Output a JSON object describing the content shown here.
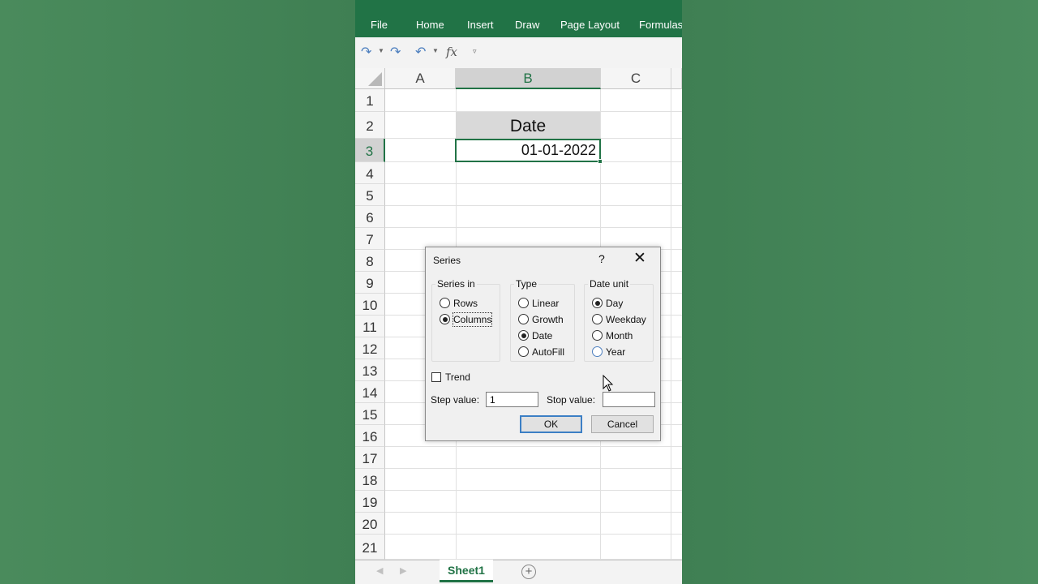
{
  "ribbon": {
    "tabs": [
      "File",
      "Home",
      "Insert",
      "Draw",
      "Page Layout",
      "Formulas"
    ]
  },
  "qat": {
    "icons": [
      "redo-icon",
      "redo-icon",
      "undo-icon",
      "function-icon",
      "customize-icon"
    ],
    "fx_label": "fx"
  },
  "grid": {
    "columns": [
      "A",
      "B",
      "C"
    ],
    "selected_column": "B",
    "rows": [
      "1",
      "2",
      "3",
      "4",
      "5",
      "6",
      "7",
      "8",
      "9",
      "10",
      "11",
      "12",
      "13",
      "14",
      "15",
      "16",
      "17",
      "18",
      "19",
      "20",
      "21"
    ],
    "selected_row": "3",
    "cells": {
      "B2": "Date",
      "B3": "01-01-2022"
    }
  },
  "sheets": {
    "tabs": [
      "Sheet1"
    ],
    "add_label": "+"
  },
  "dialog": {
    "title": "Series",
    "help": "?",
    "close": "✕",
    "series_in": {
      "label": "Series in",
      "options": [
        "Rows",
        "Columns"
      ],
      "selected": "Columns"
    },
    "type": {
      "label": "Type",
      "options": [
        "Linear",
        "Growth",
        "Date",
        "AutoFill"
      ],
      "selected": "Date"
    },
    "date_unit": {
      "label": "Date unit",
      "options": [
        "Day",
        "Weekday",
        "Month",
        "Year"
      ],
      "selected": "Day"
    },
    "trend_label": "Trend",
    "trend_checked": false,
    "step_label": "Step value:",
    "step_value": "1",
    "stop_label": "Stop value:",
    "stop_value": "",
    "ok_label": "OK",
    "cancel_label": "Cancel"
  },
  "colors": {
    "accent": "#217346",
    "background": "#46845a"
  }
}
